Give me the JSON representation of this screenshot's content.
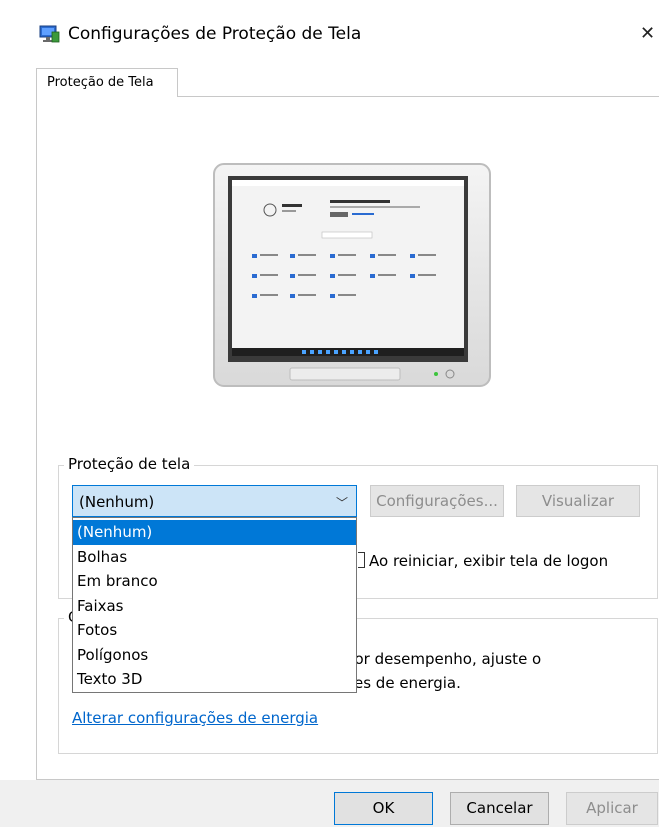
{
  "window": {
    "title": "Configurações de Proteção de Tela",
    "close_glyph": "✕"
  },
  "tab": {
    "label": "Proteção de Tela"
  },
  "screensaver_group": {
    "legend": "Proteção de tela",
    "selected": "(Nenhum)",
    "settings_button": "Configurações...",
    "preview_button": "Visualizar",
    "options": [
      "(Nenhum)",
      "Bolhas",
      "Em branco",
      "Faixas",
      "Fotos",
      "Polígonos",
      "Texto 3D"
    ],
    "logon_checkbox_label": "Ao reiniciar, exibir tela de logon"
  },
  "power_group": {
    "legend_fragment": "G",
    "text_line1": "hor desempenho, ajuste o",
    "text_line2": "es de energia.",
    "link": "Alterar configurações de energia"
  },
  "buttons": {
    "ok": "OK",
    "cancel": "Cancelar",
    "apply": "Aplicar"
  },
  "colors": {
    "accent": "#0078d7",
    "combo_bg": "#cce4f7",
    "link": "#0066cc"
  }
}
